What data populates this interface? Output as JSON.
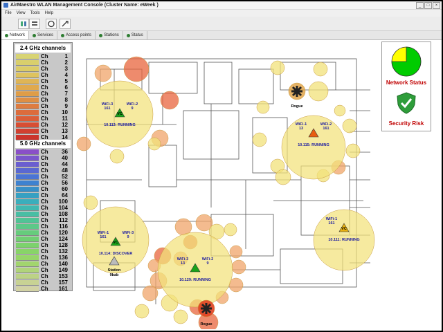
{
  "window": {
    "title": "AirMaestro WLAN Management Console (Cluster Name: eWeek )",
    "menu": [
      "File",
      "View",
      "Tools",
      "Help"
    ]
  },
  "tabs": [
    "Network",
    "Services",
    "Access points",
    "Stations",
    "Status"
  ],
  "legend24": {
    "title": "2.4 GHz channels",
    "channels": [
      {
        "label": "Ch",
        "num": "1",
        "color": "#d8d474"
      },
      {
        "label": "Ch",
        "num": "2",
        "color": "#d9cf6c"
      },
      {
        "label": "Ch",
        "num": "3",
        "color": "#dccc66"
      },
      {
        "label": "Ch",
        "num": "4",
        "color": "#dec35e"
      },
      {
        "label": "Ch",
        "num": "5",
        "color": "#dfb556"
      },
      {
        "label": "Ch",
        "num": "6",
        "color": "#e0a94e"
      },
      {
        "label": "Ch",
        "num": "7",
        "color": "#df9d48"
      },
      {
        "label": "Ch",
        "num": "8",
        "color": "#df8f44"
      },
      {
        "label": "Ch",
        "num": "9",
        "color": "#de7c40"
      },
      {
        "label": "Ch",
        "num": "10",
        "color": "#dc6c3c"
      },
      {
        "label": "Ch",
        "num": "11",
        "color": "#da5e38"
      },
      {
        "label": "Ch",
        "num": "12",
        "color": "#d74e34"
      },
      {
        "label": "Ch",
        "num": "13",
        "color": "#d24030"
      },
      {
        "label": "Ch",
        "num": "14",
        "color": "#cc342c"
      }
    ]
  },
  "legend50": {
    "title": "5.0 GHz channels",
    "channels": [
      {
        "label": "Ch",
        "num": "36",
        "color": "#8a4fc8"
      },
      {
        "label": "Ch",
        "num": "40",
        "color": "#7a56cc"
      },
      {
        "label": "Ch",
        "num": "44",
        "color": "#6a5ed0"
      },
      {
        "label": "Ch",
        "num": "48",
        "color": "#5a68d2"
      },
      {
        "label": "Ch",
        "num": "52",
        "color": "#4a74d4"
      },
      {
        "label": "Ch",
        "num": "56",
        "color": "#3e82d0"
      },
      {
        "label": "Ch",
        "num": "60",
        "color": "#3890c8"
      },
      {
        "label": "Ch",
        "num": "64",
        "color": "#36a0c2"
      },
      {
        "label": "Ch",
        "num": "100",
        "color": "#3aaebc"
      },
      {
        "label": "Ch",
        "num": "104",
        "color": "#40b8b0"
      },
      {
        "label": "Ch",
        "num": "108",
        "color": "#48bea4"
      },
      {
        "label": "Ch",
        "num": "112",
        "color": "#50c496"
      },
      {
        "label": "Ch",
        "num": "116",
        "color": "#5cc888"
      },
      {
        "label": "Ch",
        "num": "120",
        "color": "#66cc7c"
      },
      {
        "label": "Ch",
        "num": "124",
        "color": "#70cf72"
      },
      {
        "label": "Ch",
        "num": "128",
        "color": "#7cd26c"
      },
      {
        "label": "Ch",
        "num": "132",
        "color": "#88d468"
      },
      {
        "label": "Ch",
        "num": "136",
        "color": "#96d568"
      },
      {
        "label": "Ch",
        "num": "140",
        "color": "#a2d56e"
      },
      {
        "label": "Ch",
        "num": "149",
        "color": "#b0d47a"
      },
      {
        "label": "Ch",
        "num": "153",
        "color": "#bcd286"
      },
      {
        "label": "Ch",
        "num": "157",
        "color": "#c8d294"
      },
      {
        "label": "Ch",
        "num": "161",
        "color": "#d2d2a4"
      }
    ]
  },
  "status_panel": {
    "network_label": "Network Status",
    "security_label": "Security Risk",
    "network_ok_fraction": 0.75
  },
  "clusters": [
    {
      "name": "AP-A",
      "status": "10.113: RUNNING",
      "wifi_left": "WiFi-3\n161",
      "wifi_right": "WiFi-2\n9",
      "center": "VC"
    },
    {
      "name": "AP-B",
      "status": "10.115: RUNNING",
      "wifi_left": "WiFi-1\n13",
      "wifi_right": "WiFi-2\n161",
      "center": ""
    },
    {
      "name": "AP-C",
      "status": "10.114: DISCOVER",
      "wifi_left": "WiFi-1\n161",
      "wifi_right": "WiFi-3\n9",
      "center": "VC"
    },
    {
      "name": "AP-D",
      "status": "10.129: RUNNING",
      "wifi_left": "WiFi-3\n13",
      "wifi_right": "WiFi-2\n9",
      "center": ""
    },
    {
      "name": "AP-E",
      "status": "10.111: RUNNING",
      "wifi_left": "WiFi-1\n161",
      "wifi_right": "",
      "center": "VC"
    }
  ],
  "labels": {
    "rogue1": "Rogue",
    "rogue2": "Rogue",
    "station": "Station",
    "station_id": "9bab"
  },
  "colors": {
    "coverage_yellow": "#f2e27a",
    "coverage_orange": "#f0a46a",
    "coverage_red": "#e8643c",
    "status_ok": "#00cc00",
    "status_warn": "#ffff00",
    "risk_green": "#2e9d3a"
  }
}
